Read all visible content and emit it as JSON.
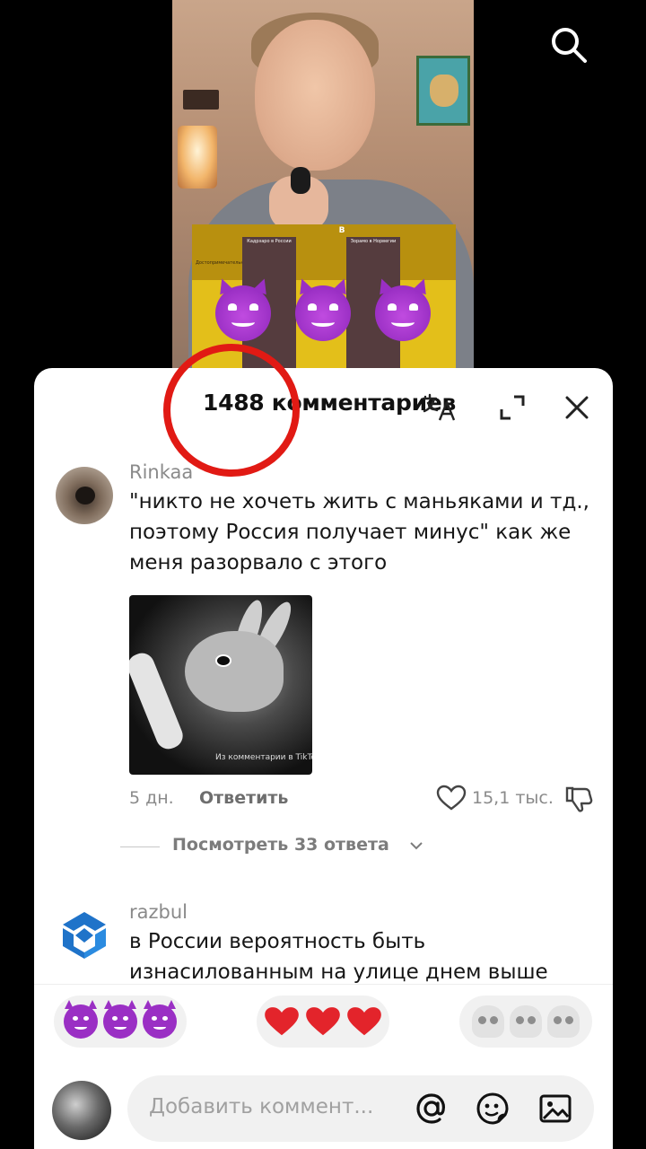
{
  "overlay": {
    "search_icon": "search-icon"
  },
  "video": {
    "table_badge": "B",
    "column1_label": "Кадрзаро в России",
    "column2_label": "Зорамо в Норвегии",
    "row_label": "Достопримечательности"
  },
  "comments_panel": {
    "count_label": "1488 комментариев",
    "icons": [
      "translate-icon",
      "expand-icon",
      "close-icon"
    ]
  },
  "comments": [
    {
      "username": "Rinkaa",
      "text": "\"никто не хочеть жить с маньяками и тд., поэтому Россия получает минус\" как же меня разорвало с этого",
      "image_watermark": "Из комментарии в TikTok",
      "time": "5 дн.",
      "reply_label": "Ответить",
      "likes": "15,1 тыс.",
      "view_replies": "Посмотреть 33 ответа"
    },
    {
      "username": "razbul",
      "text": "в России вероятность быть изнасилованным на улице днем выше"
    }
  ],
  "quick_reactions": [
    "devil-emoji",
    "heart-emoji",
    "skull-emoji"
  ],
  "input": {
    "placeholder": "Добавить коммент..."
  },
  "colors": {
    "highlight_circle": "#e11a14",
    "emoji_purple": "#9a2fc4",
    "heart_red": "#e3242b",
    "table_yellow": "#e3bf1a"
  }
}
